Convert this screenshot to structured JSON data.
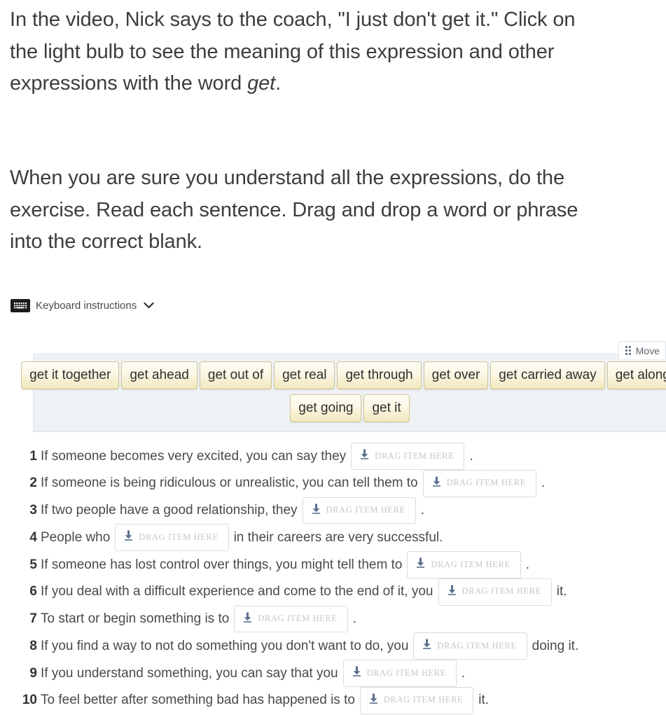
{
  "intro": {
    "paragraph1_before_em": "In the video, Nick says to the coach, \"I just don't get it.\" Click on the light bulb to see the meaning of this expression and other expressions with the word ",
    "paragraph1_em": "get",
    "paragraph1_after_em": ".",
    "paragraph2": "When you are sure you understand all the expressions, do the exercise. Read each sentence. Drag and drop a word or phrase into the correct blank."
  },
  "keyboard": {
    "icon": "keyboard-icon",
    "label": "Keyboard instructions",
    "chevron": "chevron-down-icon"
  },
  "move_tab": {
    "icon": "grip-dots-icon",
    "label": "Move"
  },
  "wordbank": {
    "rows": [
      [
        "get it together",
        "get ahead",
        "get out of",
        "get real",
        "get through",
        "get over",
        "get carried away",
        "get along"
      ],
      [
        "get going",
        "get it"
      ]
    ]
  },
  "dropzone": {
    "icon": "download-arrow-icon",
    "label": "DRAG ITEM HERE"
  },
  "questions": [
    {
      "num": "1",
      "before": "If someone becomes very excited, you can say they",
      "after": "."
    },
    {
      "num": "2",
      "before": "If someone is being ridiculous or unrealistic, you can tell them to",
      "after": "."
    },
    {
      "num": "3",
      "before": "If two people have a good relationship, they",
      "after": "."
    },
    {
      "num": "4",
      "before": "People who",
      "after": "in their careers are very successful."
    },
    {
      "num": "5",
      "before": "If someone has lost control over things, you might tell them to",
      "after": "."
    },
    {
      "num": "6",
      "before": "If you deal with a difficult experience and come to the end of it, you",
      "after": "it."
    },
    {
      "num": "7",
      "before": "To start or begin something is to",
      "after": "."
    },
    {
      "num": "8",
      "before": "If you find a way to not do something you don't want to do, you",
      "after": "doing it."
    },
    {
      "num": "9",
      "before": "If you understand something, you can say that you",
      "after": "."
    },
    {
      "num": "10",
      "before": "To feel better after something bad has happened is to",
      "after": "it."
    }
  ],
  "colors": {
    "chip_border": "#cfc494",
    "chip_fill_top": "#fefdf6",
    "chip_fill_bottom": "#f2e7bd",
    "wordbank_bg": "#eef2f5",
    "dropzone_icon": "#5a6e8c",
    "text": "#4a4a4a"
  }
}
